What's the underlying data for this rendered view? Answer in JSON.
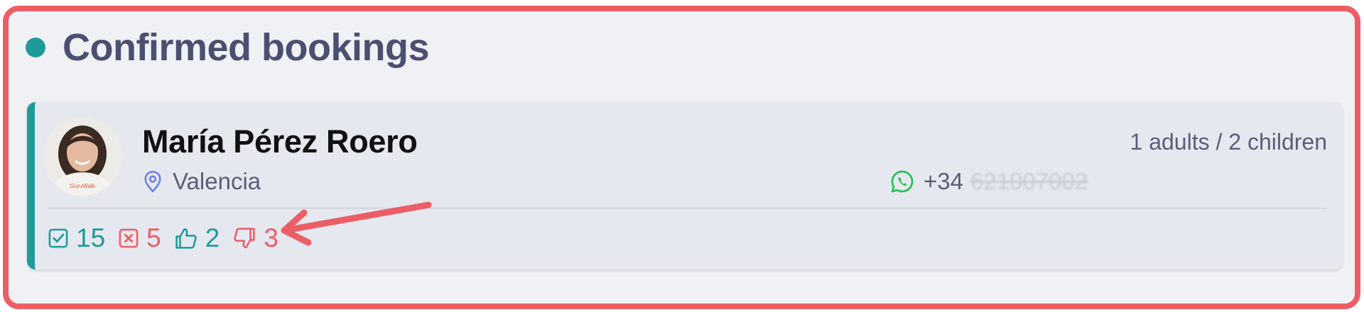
{
  "section": {
    "title": "Confirmed bookings"
  },
  "booking": {
    "guest_name": "María Pérez Roero",
    "location": "Valencia",
    "guests": "1 adults / 2 children",
    "phone_prefix": "+34",
    "phone_number_redacted": "621007002",
    "avatar_caption": "GuruWalk",
    "stats": {
      "completed": "15",
      "cancelled": "5",
      "thumbs_up": "2",
      "thumbs_down": "3"
    }
  },
  "colors": {
    "accent": "#1f9a9a",
    "alert": "#ec5e66",
    "frame": "#ec5e66",
    "whatsapp": "#25c05a",
    "location_icon": "#6a7cf0"
  },
  "icons": {
    "location": "map-pin-icon",
    "phone": "whatsapp-icon",
    "completed": "checkbox-checked-icon",
    "cancelled": "x-square-icon",
    "thumbs_up": "thumbs-up-icon",
    "thumbs_down": "thumbs-down-icon"
  }
}
